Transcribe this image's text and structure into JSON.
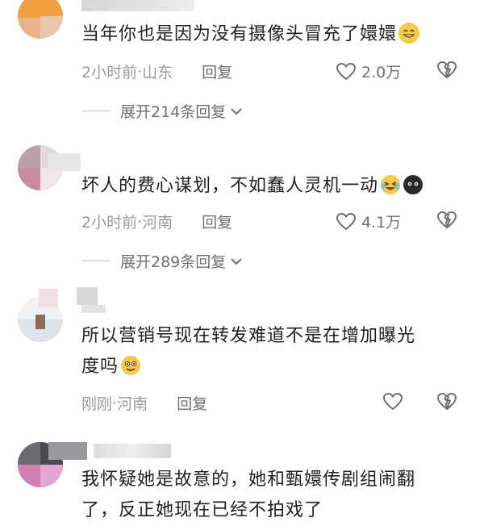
{
  "comments": [
    {
      "text": "当年你也是因为没有摄像头冒充了嬛嬛",
      "time": "2小时前",
      "location": "山东",
      "reply_label": "回复",
      "likes": "2.0万",
      "expand_label": "展开214条回复"
    },
    {
      "text": "坏人的费心谋划，不如蠢人灵机一动",
      "time": "2小时前",
      "location": "河南",
      "reply_label": "回复",
      "likes": "4.1万",
      "expand_label": "展开289条回复"
    },
    {
      "text_line1": "所以营销号现在转发难道不是在增加曝光",
      "text_line2": "度吗",
      "time": "刚刚",
      "location": "河南",
      "reply_label": "回复"
    },
    {
      "text_line1": "我怀疑她是故意的，她和甄嬛传剧组闹翻",
      "text_line2": "了，反正她现在已经不拍戏了"
    }
  ],
  "separator": " · ",
  "colors": {
    "meta": "#9a9a9a",
    "text": "#1f1f1f",
    "emoji_yellow": "#f7c948"
  },
  "icons": [
    "heart-outline-icon",
    "broken-heart-icon",
    "chevron-down-icon",
    "grin-emoji-icon",
    "laugh-cry-emoji-icon",
    "dark-face-emoji-icon",
    "smile-emoji-icon"
  ]
}
